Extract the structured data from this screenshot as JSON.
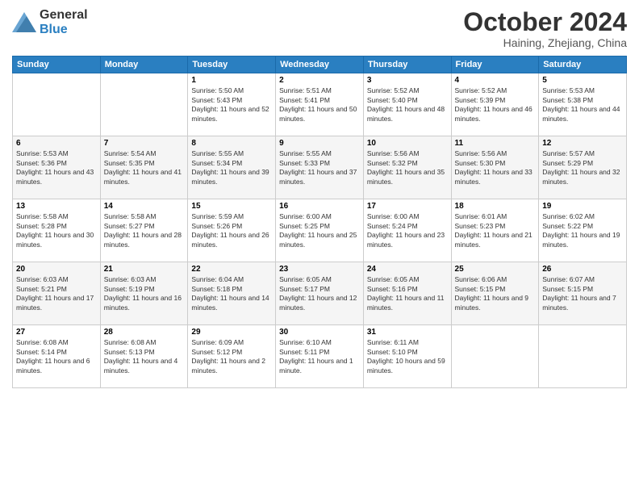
{
  "logo": {
    "general": "General",
    "blue": "Blue"
  },
  "title": "October 2024",
  "subtitle": "Haining, Zhejiang, China",
  "headers": [
    "Sunday",
    "Monday",
    "Tuesday",
    "Wednesday",
    "Thursday",
    "Friday",
    "Saturday"
  ],
  "weeks": [
    [
      {
        "day": "",
        "info": ""
      },
      {
        "day": "",
        "info": ""
      },
      {
        "day": "1",
        "info": "Sunrise: 5:50 AM\nSunset: 5:43 PM\nDaylight: 11 hours and 52 minutes."
      },
      {
        "day": "2",
        "info": "Sunrise: 5:51 AM\nSunset: 5:41 PM\nDaylight: 11 hours and 50 minutes."
      },
      {
        "day": "3",
        "info": "Sunrise: 5:52 AM\nSunset: 5:40 PM\nDaylight: 11 hours and 48 minutes."
      },
      {
        "day": "4",
        "info": "Sunrise: 5:52 AM\nSunset: 5:39 PM\nDaylight: 11 hours and 46 minutes."
      },
      {
        "day": "5",
        "info": "Sunrise: 5:53 AM\nSunset: 5:38 PM\nDaylight: 11 hours and 44 minutes."
      }
    ],
    [
      {
        "day": "6",
        "info": "Sunrise: 5:53 AM\nSunset: 5:36 PM\nDaylight: 11 hours and 43 minutes."
      },
      {
        "day": "7",
        "info": "Sunrise: 5:54 AM\nSunset: 5:35 PM\nDaylight: 11 hours and 41 minutes."
      },
      {
        "day": "8",
        "info": "Sunrise: 5:55 AM\nSunset: 5:34 PM\nDaylight: 11 hours and 39 minutes."
      },
      {
        "day": "9",
        "info": "Sunrise: 5:55 AM\nSunset: 5:33 PM\nDaylight: 11 hours and 37 minutes."
      },
      {
        "day": "10",
        "info": "Sunrise: 5:56 AM\nSunset: 5:32 PM\nDaylight: 11 hours and 35 minutes."
      },
      {
        "day": "11",
        "info": "Sunrise: 5:56 AM\nSunset: 5:30 PM\nDaylight: 11 hours and 33 minutes."
      },
      {
        "day": "12",
        "info": "Sunrise: 5:57 AM\nSunset: 5:29 PM\nDaylight: 11 hours and 32 minutes."
      }
    ],
    [
      {
        "day": "13",
        "info": "Sunrise: 5:58 AM\nSunset: 5:28 PM\nDaylight: 11 hours and 30 minutes."
      },
      {
        "day": "14",
        "info": "Sunrise: 5:58 AM\nSunset: 5:27 PM\nDaylight: 11 hours and 28 minutes."
      },
      {
        "day": "15",
        "info": "Sunrise: 5:59 AM\nSunset: 5:26 PM\nDaylight: 11 hours and 26 minutes."
      },
      {
        "day": "16",
        "info": "Sunrise: 6:00 AM\nSunset: 5:25 PM\nDaylight: 11 hours and 25 minutes."
      },
      {
        "day": "17",
        "info": "Sunrise: 6:00 AM\nSunset: 5:24 PM\nDaylight: 11 hours and 23 minutes."
      },
      {
        "day": "18",
        "info": "Sunrise: 6:01 AM\nSunset: 5:23 PM\nDaylight: 11 hours and 21 minutes."
      },
      {
        "day": "19",
        "info": "Sunrise: 6:02 AM\nSunset: 5:22 PM\nDaylight: 11 hours and 19 minutes."
      }
    ],
    [
      {
        "day": "20",
        "info": "Sunrise: 6:03 AM\nSunset: 5:21 PM\nDaylight: 11 hours and 17 minutes."
      },
      {
        "day": "21",
        "info": "Sunrise: 6:03 AM\nSunset: 5:19 PM\nDaylight: 11 hours and 16 minutes."
      },
      {
        "day": "22",
        "info": "Sunrise: 6:04 AM\nSunset: 5:18 PM\nDaylight: 11 hours and 14 minutes."
      },
      {
        "day": "23",
        "info": "Sunrise: 6:05 AM\nSunset: 5:17 PM\nDaylight: 11 hours and 12 minutes."
      },
      {
        "day": "24",
        "info": "Sunrise: 6:05 AM\nSunset: 5:16 PM\nDaylight: 11 hours and 11 minutes."
      },
      {
        "day": "25",
        "info": "Sunrise: 6:06 AM\nSunset: 5:15 PM\nDaylight: 11 hours and 9 minutes."
      },
      {
        "day": "26",
        "info": "Sunrise: 6:07 AM\nSunset: 5:15 PM\nDaylight: 11 hours and 7 minutes."
      }
    ],
    [
      {
        "day": "27",
        "info": "Sunrise: 6:08 AM\nSunset: 5:14 PM\nDaylight: 11 hours and 6 minutes."
      },
      {
        "day": "28",
        "info": "Sunrise: 6:08 AM\nSunset: 5:13 PM\nDaylight: 11 hours and 4 minutes."
      },
      {
        "day": "29",
        "info": "Sunrise: 6:09 AM\nSunset: 5:12 PM\nDaylight: 11 hours and 2 minutes."
      },
      {
        "day": "30",
        "info": "Sunrise: 6:10 AM\nSunset: 5:11 PM\nDaylight: 11 hours and 1 minute."
      },
      {
        "day": "31",
        "info": "Sunrise: 6:11 AM\nSunset: 5:10 PM\nDaylight: 10 hours and 59 minutes."
      },
      {
        "day": "",
        "info": ""
      },
      {
        "day": "",
        "info": ""
      }
    ]
  ]
}
